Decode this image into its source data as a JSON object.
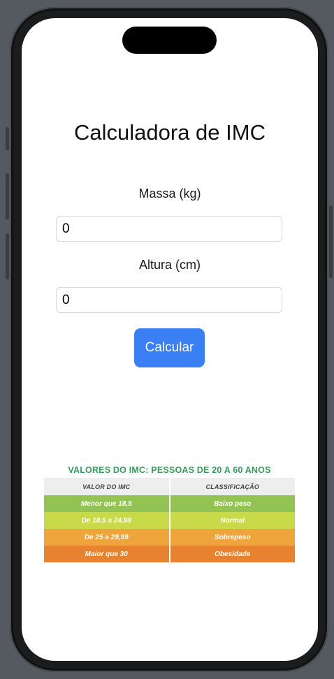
{
  "app": {
    "title": "Calculadora de IMC"
  },
  "form": {
    "mass_label": "Massa (kg)",
    "mass_value": "0",
    "height_label": "Altura (cm)",
    "height_value": "0",
    "calculate_label": "Calcular",
    "button_color": "#3b7ff5"
  },
  "imc_table": {
    "title": "VALORES DO IMC: PESSOAS DE 20 A 60 ANOS",
    "title_color": "#3a9a5c",
    "headers": [
      "VALOR DO IMC",
      "CLASSIFICAÇÃO"
    ],
    "rows": [
      {
        "value": "Menor que 18,5",
        "classification": "Baixo peso",
        "color": "#93c353"
      },
      {
        "value": "De 18,5 a 24,99",
        "classification": "Normal",
        "color": "#c8d94a"
      },
      {
        "value": "De 25 a 29,99",
        "classification": "Sobrepeso",
        "color": "#efa53c"
      },
      {
        "value": "Maior que 30",
        "classification": "Obesidade",
        "color": "#e8822e"
      }
    ]
  }
}
